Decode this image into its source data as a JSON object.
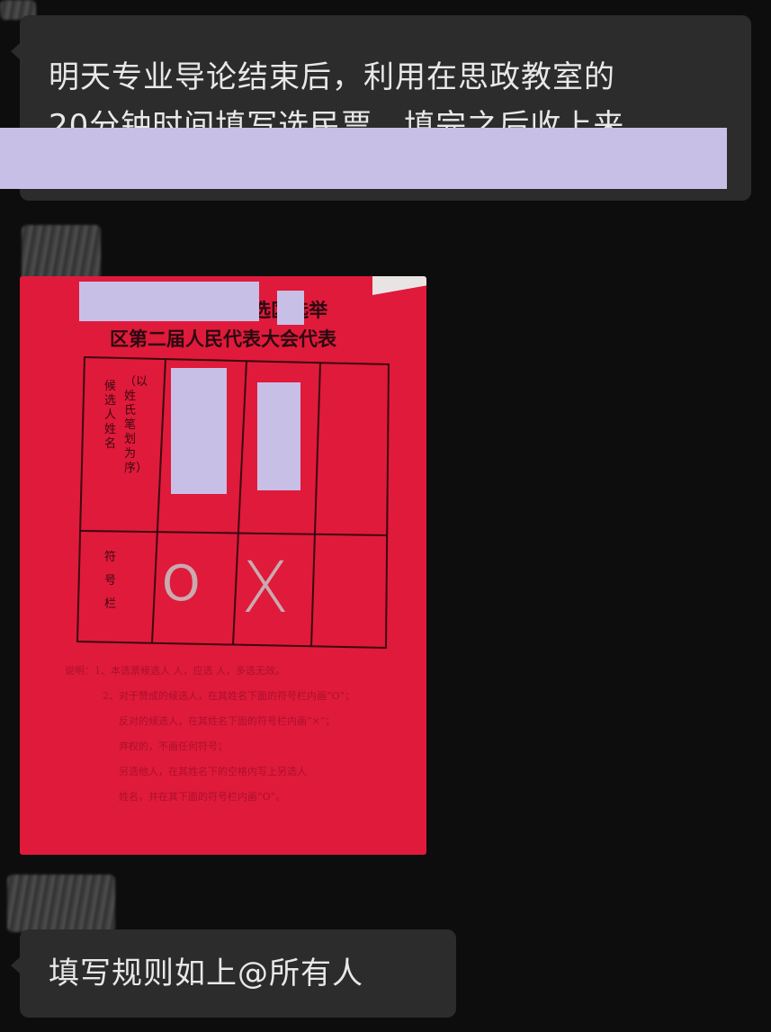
{
  "messages": [
    {
      "type": "text",
      "text_line1": "明天专业导论结束后，利用在思政教室的",
      "text_line2": "20分钟时间填写选民票，填完之后收上来"
    },
    {
      "type": "image",
      "ballot": {
        "title_line1": "第 选区选举",
        "title_line2": "区第二届人民代表大会代表",
        "candidate_header": "候选人姓名",
        "candidate_note": "（以姓氏笔划为序）",
        "mark_header": "符号栏",
        "mark_1": "O",
        "mark_2": "X",
        "notes": [
          "说明：1、本选票候选人 人，应选 人，多选无效。",
          "2、对于赞成的候选人，在其姓名下面的符号栏内画“O”；",
          "反对的候选人，在其姓名下面的符号栏内画“×”；",
          "弃权的，不画任何符号；",
          "另选他人，在其姓名下的空格内写上另选人",
          "姓名，并在其下面的符号栏内画“O”。"
        ]
      }
    },
    {
      "type": "text",
      "text": "填写规则如上@所有人"
    }
  ],
  "colors": {
    "background": "#0d0d0d",
    "bubble": "#2c2c2c",
    "text": "#e8e8e8",
    "ballot": "#e01a3b",
    "redaction": "#c8bfe7"
  }
}
